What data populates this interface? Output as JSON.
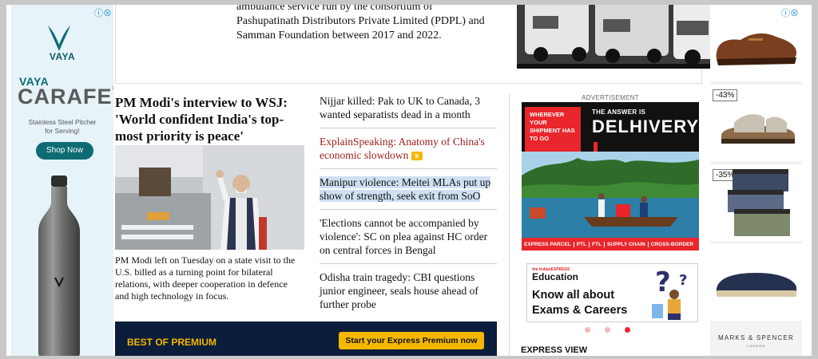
{
  "left_ad": {
    "adchoice": "ⓘ⊗",
    "brand_small": "VAYA",
    "brand": "VAYA",
    "product": "CARAFE",
    "reg": "®",
    "tagline_1": "Stainless Steel Pitcher",
    "tagline_2": "for Serving!",
    "cta": "Shop Now",
    "accent": "#0e6b74"
  },
  "top_story": {
    "line1": "ambulance service run by the consortium of",
    "line2": "Pashupatinath Distributors Private Limited (PDPL) and",
    "line3": "Samman Foundation between 2017 and 2022."
  },
  "lead": {
    "headline": "PM Modi's interview to WSJ: 'World confident India's top-most priority is peace'",
    "caption": "PM Modi left on Tuesday on a state visit to the U.S. billed as a turning point for bilateral relations, with deeper cooperation in defence and high technology in focus."
  },
  "stories": [
    {
      "text": "Nijjar killed: Pak to UK to Canada, 3 wanted separatists dead in a month"
    },
    {
      "text": "ExplainSpeaking: Anatomy of China's economic slowdown",
      "premium_icon": "crown-icon"
    },
    {
      "text": "Manipur violence: Meitei MLAs put up show of strength, seek exit from SoO"
    },
    {
      "text": "'Elections cannot be accompanied by violence': SC on plea against HC order on central forces in Bengal"
    },
    {
      "text": "Odisha train tragedy: CBI questions junior engineer, seals house ahead of further probe"
    }
  ],
  "premium": {
    "label": "BEST OF PREMIUM",
    "cta": "Start your Express Premium now",
    "bg": "#0b1d3a",
    "accent": "#f5b700"
  },
  "right_ads": {
    "advertisement_label": "ADVERTISEMENT",
    "delhivery": {
      "red_text": "WHEREVER YOUR SHIPMENT HAS TO GO",
      "answer": "THE ANSWER IS",
      "logo": "DELHIVERY",
      "footer": [
        "EXPRESS PARCEL",
        "PTL",
        "FTL",
        "SUPPLY CHAIN",
        "CROSS-BORDER"
      ],
      "accent": "#e8262b"
    },
    "education": {
      "small": "the IndianEXPRESS",
      "title": "Education",
      "line1": "Know all about",
      "line2": "Exams & Careers"
    },
    "carousel_active": 3
  },
  "express_view": "EXPRESS VIEW",
  "ms_ad": {
    "adchoice": "ⓘ⊗",
    "discount_1": "-43%",
    "discount_2": "-35%",
    "logo": "MARKS & SPENCER",
    "sub": "LONDON"
  }
}
